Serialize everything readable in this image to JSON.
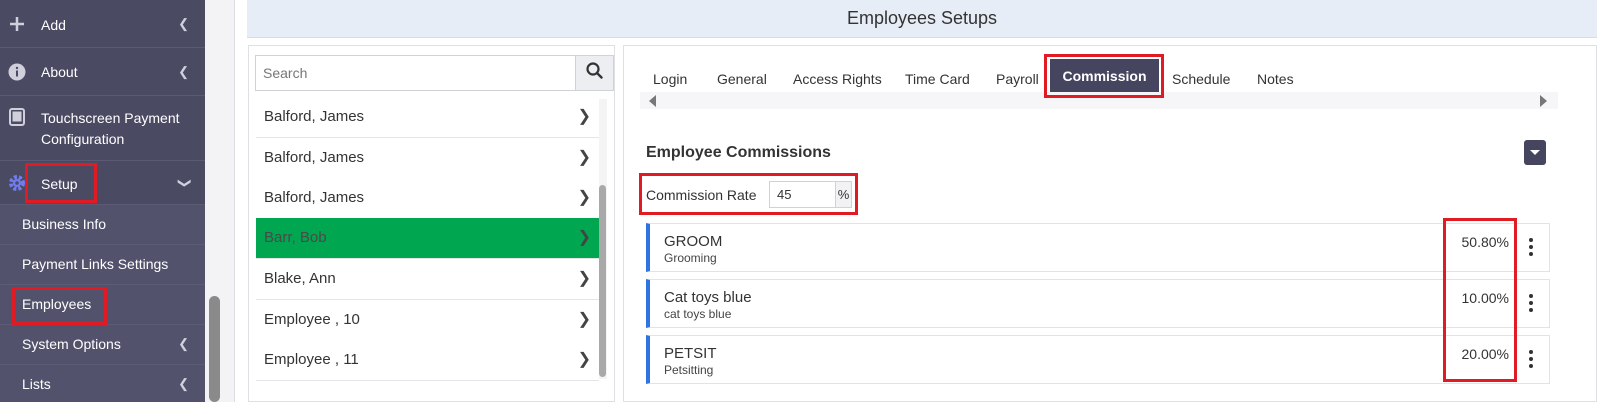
{
  "sidebar": {
    "items": [
      {
        "label": "Add",
        "icon": "plus-icon"
      },
      {
        "label": "About",
        "icon": "info-icon"
      },
      {
        "label": "Touchscreen Payment Configuration",
        "line1": "Touchscreen Payment",
        "line2": "Configuration",
        "icon": "tablet-icon"
      },
      {
        "label": "Setup",
        "icon": "gear-icon"
      }
    ],
    "setup_subitems": [
      {
        "label": "Business Info"
      },
      {
        "label": "Payment Links Settings"
      },
      {
        "label": "Employees"
      },
      {
        "label": "System Options"
      },
      {
        "label": "Lists"
      }
    ]
  },
  "header": {
    "title": "Employees Setups"
  },
  "search": {
    "placeholder": "Search",
    "value": ""
  },
  "employees": [
    {
      "name": "Balford, James"
    },
    {
      "name": "Balford, James"
    },
    {
      "name": "Balford, James"
    },
    {
      "name": "Barr, Bob",
      "selected": true
    },
    {
      "name": "Blake, Ann"
    },
    {
      "name": "Employee , 10"
    },
    {
      "name": "Employee , 11"
    }
  ],
  "tabs": [
    {
      "label": "Login"
    },
    {
      "label": "General"
    },
    {
      "label": "Access Rights"
    },
    {
      "label": "Time Card"
    },
    {
      "label": "Payroll"
    },
    {
      "label": "Commission",
      "active": true
    },
    {
      "label": "Schedule"
    },
    {
      "label": "Notes"
    }
  ],
  "commission": {
    "section_title": "Employee Commissions",
    "rate_label": "Commission Rate",
    "rate_value": "45",
    "rate_suffix": "%",
    "items": [
      {
        "name": "GROOM",
        "description": "Grooming",
        "percent": "50.80%"
      },
      {
        "name": "Cat toys blue",
        "description": "cat toys blue",
        "percent": "10.00%"
      },
      {
        "name": "PETSIT",
        "description": "Petsitting",
        "percent": "20.00%"
      }
    ]
  },
  "colors": {
    "sidebar_bg": "#4a4a63",
    "active_tab_bg": "#454560",
    "selected_row_bg": "#00a650",
    "card_accent": "#2f74e0",
    "highlight_box": "#e01b24"
  }
}
